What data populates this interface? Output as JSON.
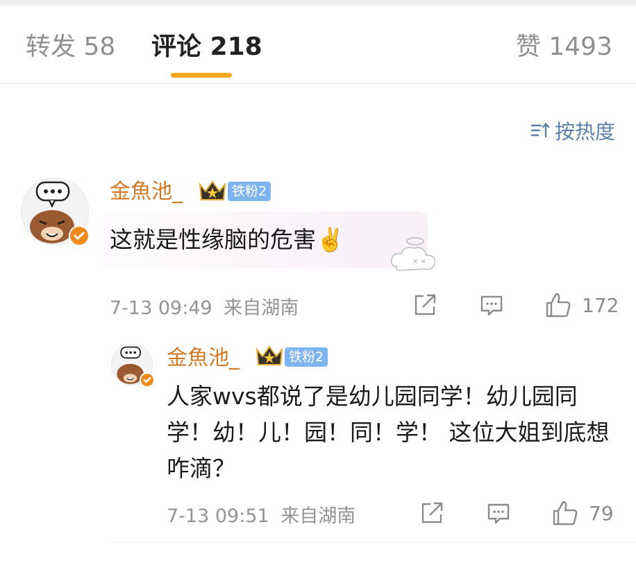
{
  "tabs": {
    "repost_label": "转发",
    "repost_count": "58",
    "comment_label": "评论",
    "comment_count": "218",
    "like_label": "赞",
    "like_count": "1493"
  },
  "sort": {
    "label": "按热度",
    "icon": "sort-icon"
  },
  "comments": [
    {
      "username": "金魚池_",
      "fan_badge": "铁粉2",
      "text": "这就是性缘脑的危害✌️",
      "timestamp": "7-13 09:49",
      "location": "来自湖南",
      "like_count": "172"
    }
  ],
  "reply": {
    "username": "金魚池_",
    "fan_badge": "铁粉2",
    "text": "人家wvs都说了是幼儿园同学！幼儿园同学！幼！儿！园！同！学！ 这位大姐到底想咋滴？",
    "timestamp": "7-13 09:51",
    "location": "来自湖南",
    "like_count": "79"
  },
  "colors": {
    "accent": "#f5a623",
    "username": "#d07a26",
    "link_blue": "#5a7fa8",
    "badge_blue": "#7fb4f0",
    "verified": "#f08c1e"
  }
}
